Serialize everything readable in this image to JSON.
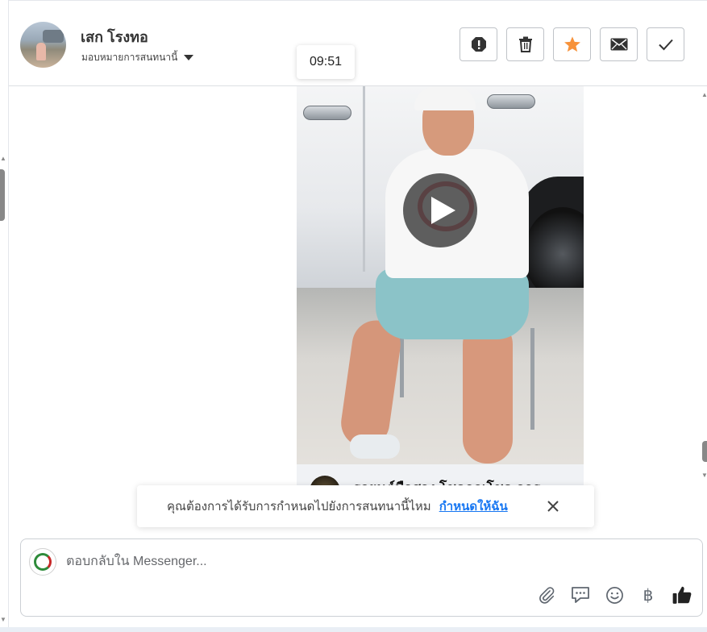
{
  "header": {
    "contact_name": "เสก โรงทอ",
    "assign_label": "มอบหมายการสนทนานี้",
    "actions": [
      {
        "name": "spam",
        "icon": "alert-octagon-icon"
      },
      {
        "name": "delete",
        "icon": "trash-icon"
      },
      {
        "name": "star",
        "icon": "star-icon",
        "color": "#f7923a"
      },
      {
        "name": "mark-unread",
        "icon": "envelope-icon"
      },
      {
        "name": "mark-done",
        "icon": "check-icon"
      }
    ]
  },
  "message": {
    "timestamp": "09:51",
    "video_caption": "รถยนต์มือสอง โชคลกเโชค ลอร"
  },
  "assign_toast": {
    "message": "คุณต้องการได้รับการกำหนดไปยังการสนทนานี้ไหม",
    "link_label": "กำหนดให้ฉัน"
  },
  "composer": {
    "placeholder": "ตอบกลับใน Messenger...",
    "currency_symbol": "฿",
    "tools": [
      "paperclip-icon",
      "saved-reply-icon",
      "emoji-icon",
      "currency-icon",
      "thumbs-up-icon"
    ]
  },
  "colors": {
    "accent": "#1877f2",
    "star": "#f7923a",
    "border": "#bfc3c8"
  }
}
